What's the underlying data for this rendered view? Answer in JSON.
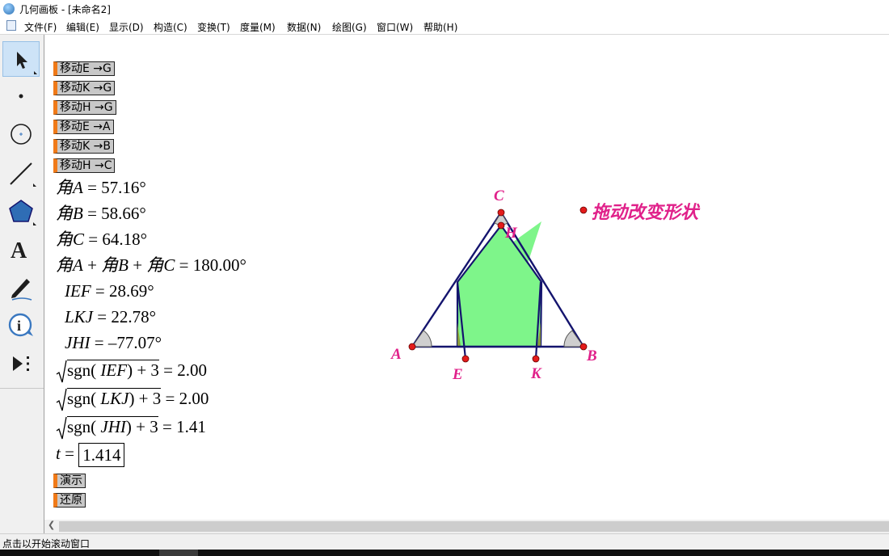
{
  "window": {
    "title": "几何画板 - [未命名2]"
  },
  "menu": [
    "文件(F)",
    "编辑(E)",
    "显示(D)",
    "构造(C)",
    "变换(T)",
    "度量(M)",
    "数据(N)",
    "绘图(G)",
    "窗口(W)",
    "帮助(H)"
  ],
  "tools": [
    "arrow-select-tool",
    "point-tool",
    "compass-tool",
    "straightedge-tool",
    "polygon-tool",
    "text-tool",
    "marker-tool",
    "information-tool",
    "custom-tools"
  ],
  "buttons": {
    "move_e_g": "移动E →G",
    "move_k_g": "移动K →G",
    "move_h_g": "移动H →G",
    "move_e_a": "移动E →A",
    "move_k_b": "移动K →B",
    "move_h_c": "移动H →C",
    "demo": "演示",
    "restore": "还原"
  },
  "measurements": {
    "angle_a": {
      "prefix": "角",
      "var": "A",
      "value": "= 57.16°"
    },
    "angle_b": {
      "prefix": "角",
      "var": "B",
      "value": "= 58.66°"
    },
    "angle_c": {
      "prefix": "角",
      "var": "C",
      "value": "= 64.18°"
    },
    "angle_sum": {
      "p1": "角",
      "v1": "A",
      "plus1": " + ",
      "p2": "角",
      "v2": "B",
      "plus2": " + ",
      "p3": "角",
      "v3": "C",
      "value": " = 180.00°"
    },
    "ief": {
      "var": "IEF",
      "value": " = 28.69°"
    },
    "lkj": {
      "var": "LKJ",
      "value": " = 22.78°"
    },
    "jhi": {
      "var": "JHI",
      "value": " = –77.07°"
    },
    "sqrt_ief": {
      "fn": "sgn( ",
      "var": "IEF",
      "tail": ") + 3",
      "value": " = 2.00"
    },
    "sqrt_lkj": {
      "fn": "sgn( ",
      "var": "LKJ",
      "tail": ") + 3",
      "value": " = 2.00"
    },
    "sqrt_jhi": {
      "fn": "sgn( ",
      "var": "JHI",
      "tail": ") + 3",
      "value": " = 1.41"
    },
    "param_t": {
      "var": "t",
      "eq": " = ",
      "value": "1.414"
    }
  },
  "geometry": {
    "labels": {
      "a": "A",
      "b": "B",
      "c": "C",
      "e": "E",
      "k": "K",
      "h": "H"
    },
    "drag_label": "拖动改变形状",
    "colors": {
      "line": "#14146e",
      "fill": "#7ef58a",
      "point": "#e31b1b",
      "label": "#e0218a"
    }
  },
  "status": {
    "text": "点击以开始滚动窗口"
  }
}
